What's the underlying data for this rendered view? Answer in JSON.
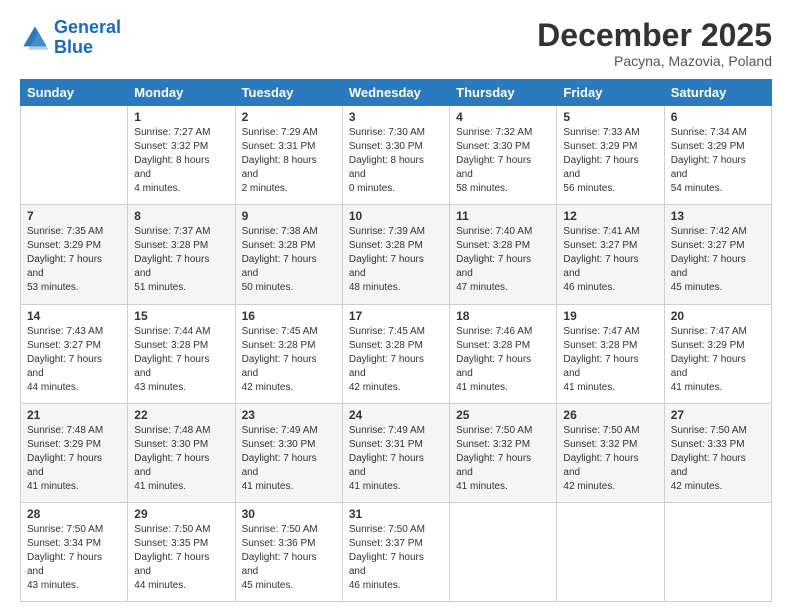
{
  "header": {
    "logo_line1": "General",
    "logo_line2": "Blue",
    "month": "December 2025",
    "location": "Pacyna, Mazovia, Poland"
  },
  "days_of_week": [
    "Sunday",
    "Monday",
    "Tuesday",
    "Wednesday",
    "Thursday",
    "Friday",
    "Saturday"
  ],
  "weeks": [
    [
      {
        "day": null,
        "sunrise": null,
        "sunset": null,
        "daylight": null
      },
      {
        "day": "1",
        "sunrise": "7:27 AM",
        "sunset": "3:32 PM",
        "daylight": "8 hours and 4 minutes."
      },
      {
        "day": "2",
        "sunrise": "7:29 AM",
        "sunset": "3:31 PM",
        "daylight": "8 hours and 2 minutes."
      },
      {
        "day": "3",
        "sunrise": "7:30 AM",
        "sunset": "3:30 PM",
        "daylight": "8 hours and 0 minutes."
      },
      {
        "day": "4",
        "sunrise": "7:32 AM",
        "sunset": "3:30 PM",
        "daylight": "7 hours and 58 minutes."
      },
      {
        "day": "5",
        "sunrise": "7:33 AM",
        "sunset": "3:29 PM",
        "daylight": "7 hours and 56 minutes."
      },
      {
        "day": "6",
        "sunrise": "7:34 AM",
        "sunset": "3:29 PM",
        "daylight": "7 hours and 54 minutes."
      }
    ],
    [
      {
        "day": "7",
        "sunrise": "7:35 AM",
        "sunset": "3:29 PM",
        "daylight": "7 hours and 53 minutes."
      },
      {
        "day": "8",
        "sunrise": "7:37 AM",
        "sunset": "3:28 PM",
        "daylight": "7 hours and 51 minutes."
      },
      {
        "day": "9",
        "sunrise": "7:38 AM",
        "sunset": "3:28 PM",
        "daylight": "7 hours and 50 minutes."
      },
      {
        "day": "10",
        "sunrise": "7:39 AM",
        "sunset": "3:28 PM",
        "daylight": "7 hours and 48 minutes."
      },
      {
        "day": "11",
        "sunrise": "7:40 AM",
        "sunset": "3:28 PM",
        "daylight": "7 hours and 47 minutes."
      },
      {
        "day": "12",
        "sunrise": "7:41 AM",
        "sunset": "3:27 PM",
        "daylight": "7 hours and 46 minutes."
      },
      {
        "day": "13",
        "sunrise": "7:42 AM",
        "sunset": "3:27 PM",
        "daylight": "7 hours and 45 minutes."
      }
    ],
    [
      {
        "day": "14",
        "sunrise": "7:43 AM",
        "sunset": "3:27 PM",
        "daylight": "7 hours and 44 minutes."
      },
      {
        "day": "15",
        "sunrise": "7:44 AM",
        "sunset": "3:28 PM",
        "daylight": "7 hours and 43 minutes."
      },
      {
        "day": "16",
        "sunrise": "7:45 AM",
        "sunset": "3:28 PM",
        "daylight": "7 hours and 42 minutes."
      },
      {
        "day": "17",
        "sunrise": "7:45 AM",
        "sunset": "3:28 PM",
        "daylight": "7 hours and 42 minutes."
      },
      {
        "day": "18",
        "sunrise": "7:46 AM",
        "sunset": "3:28 PM",
        "daylight": "7 hours and 41 minutes."
      },
      {
        "day": "19",
        "sunrise": "7:47 AM",
        "sunset": "3:28 PM",
        "daylight": "7 hours and 41 minutes."
      },
      {
        "day": "20",
        "sunrise": "7:47 AM",
        "sunset": "3:29 PM",
        "daylight": "7 hours and 41 minutes."
      }
    ],
    [
      {
        "day": "21",
        "sunrise": "7:48 AM",
        "sunset": "3:29 PM",
        "daylight": "7 hours and 41 minutes."
      },
      {
        "day": "22",
        "sunrise": "7:48 AM",
        "sunset": "3:30 PM",
        "daylight": "7 hours and 41 minutes."
      },
      {
        "day": "23",
        "sunrise": "7:49 AM",
        "sunset": "3:30 PM",
        "daylight": "7 hours and 41 minutes."
      },
      {
        "day": "24",
        "sunrise": "7:49 AM",
        "sunset": "3:31 PM",
        "daylight": "7 hours and 41 minutes."
      },
      {
        "day": "25",
        "sunrise": "7:50 AM",
        "sunset": "3:32 PM",
        "daylight": "7 hours and 41 minutes."
      },
      {
        "day": "26",
        "sunrise": "7:50 AM",
        "sunset": "3:32 PM",
        "daylight": "7 hours and 42 minutes."
      },
      {
        "day": "27",
        "sunrise": "7:50 AM",
        "sunset": "3:33 PM",
        "daylight": "7 hours and 42 minutes."
      }
    ],
    [
      {
        "day": "28",
        "sunrise": "7:50 AM",
        "sunset": "3:34 PM",
        "daylight": "7 hours and 43 minutes."
      },
      {
        "day": "29",
        "sunrise": "7:50 AM",
        "sunset": "3:35 PM",
        "daylight": "7 hours and 44 minutes."
      },
      {
        "day": "30",
        "sunrise": "7:50 AM",
        "sunset": "3:36 PM",
        "daylight": "7 hours and 45 minutes."
      },
      {
        "day": "31",
        "sunrise": "7:50 AM",
        "sunset": "3:37 PM",
        "daylight": "7 hours and 46 minutes."
      },
      {
        "day": null,
        "sunrise": null,
        "sunset": null,
        "daylight": null
      },
      {
        "day": null,
        "sunrise": null,
        "sunset": null,
        "daylight": null
      },
      {
        "day": null,
        "sunrise": null,
        "sunset": null,
        "daylight": null
      }
    ]
  ],
  "labels": {
    "sunrise": "Sunrise:",
    "sunset": "Sunset:",
    "daylight": "Daylight:"
  }
}
